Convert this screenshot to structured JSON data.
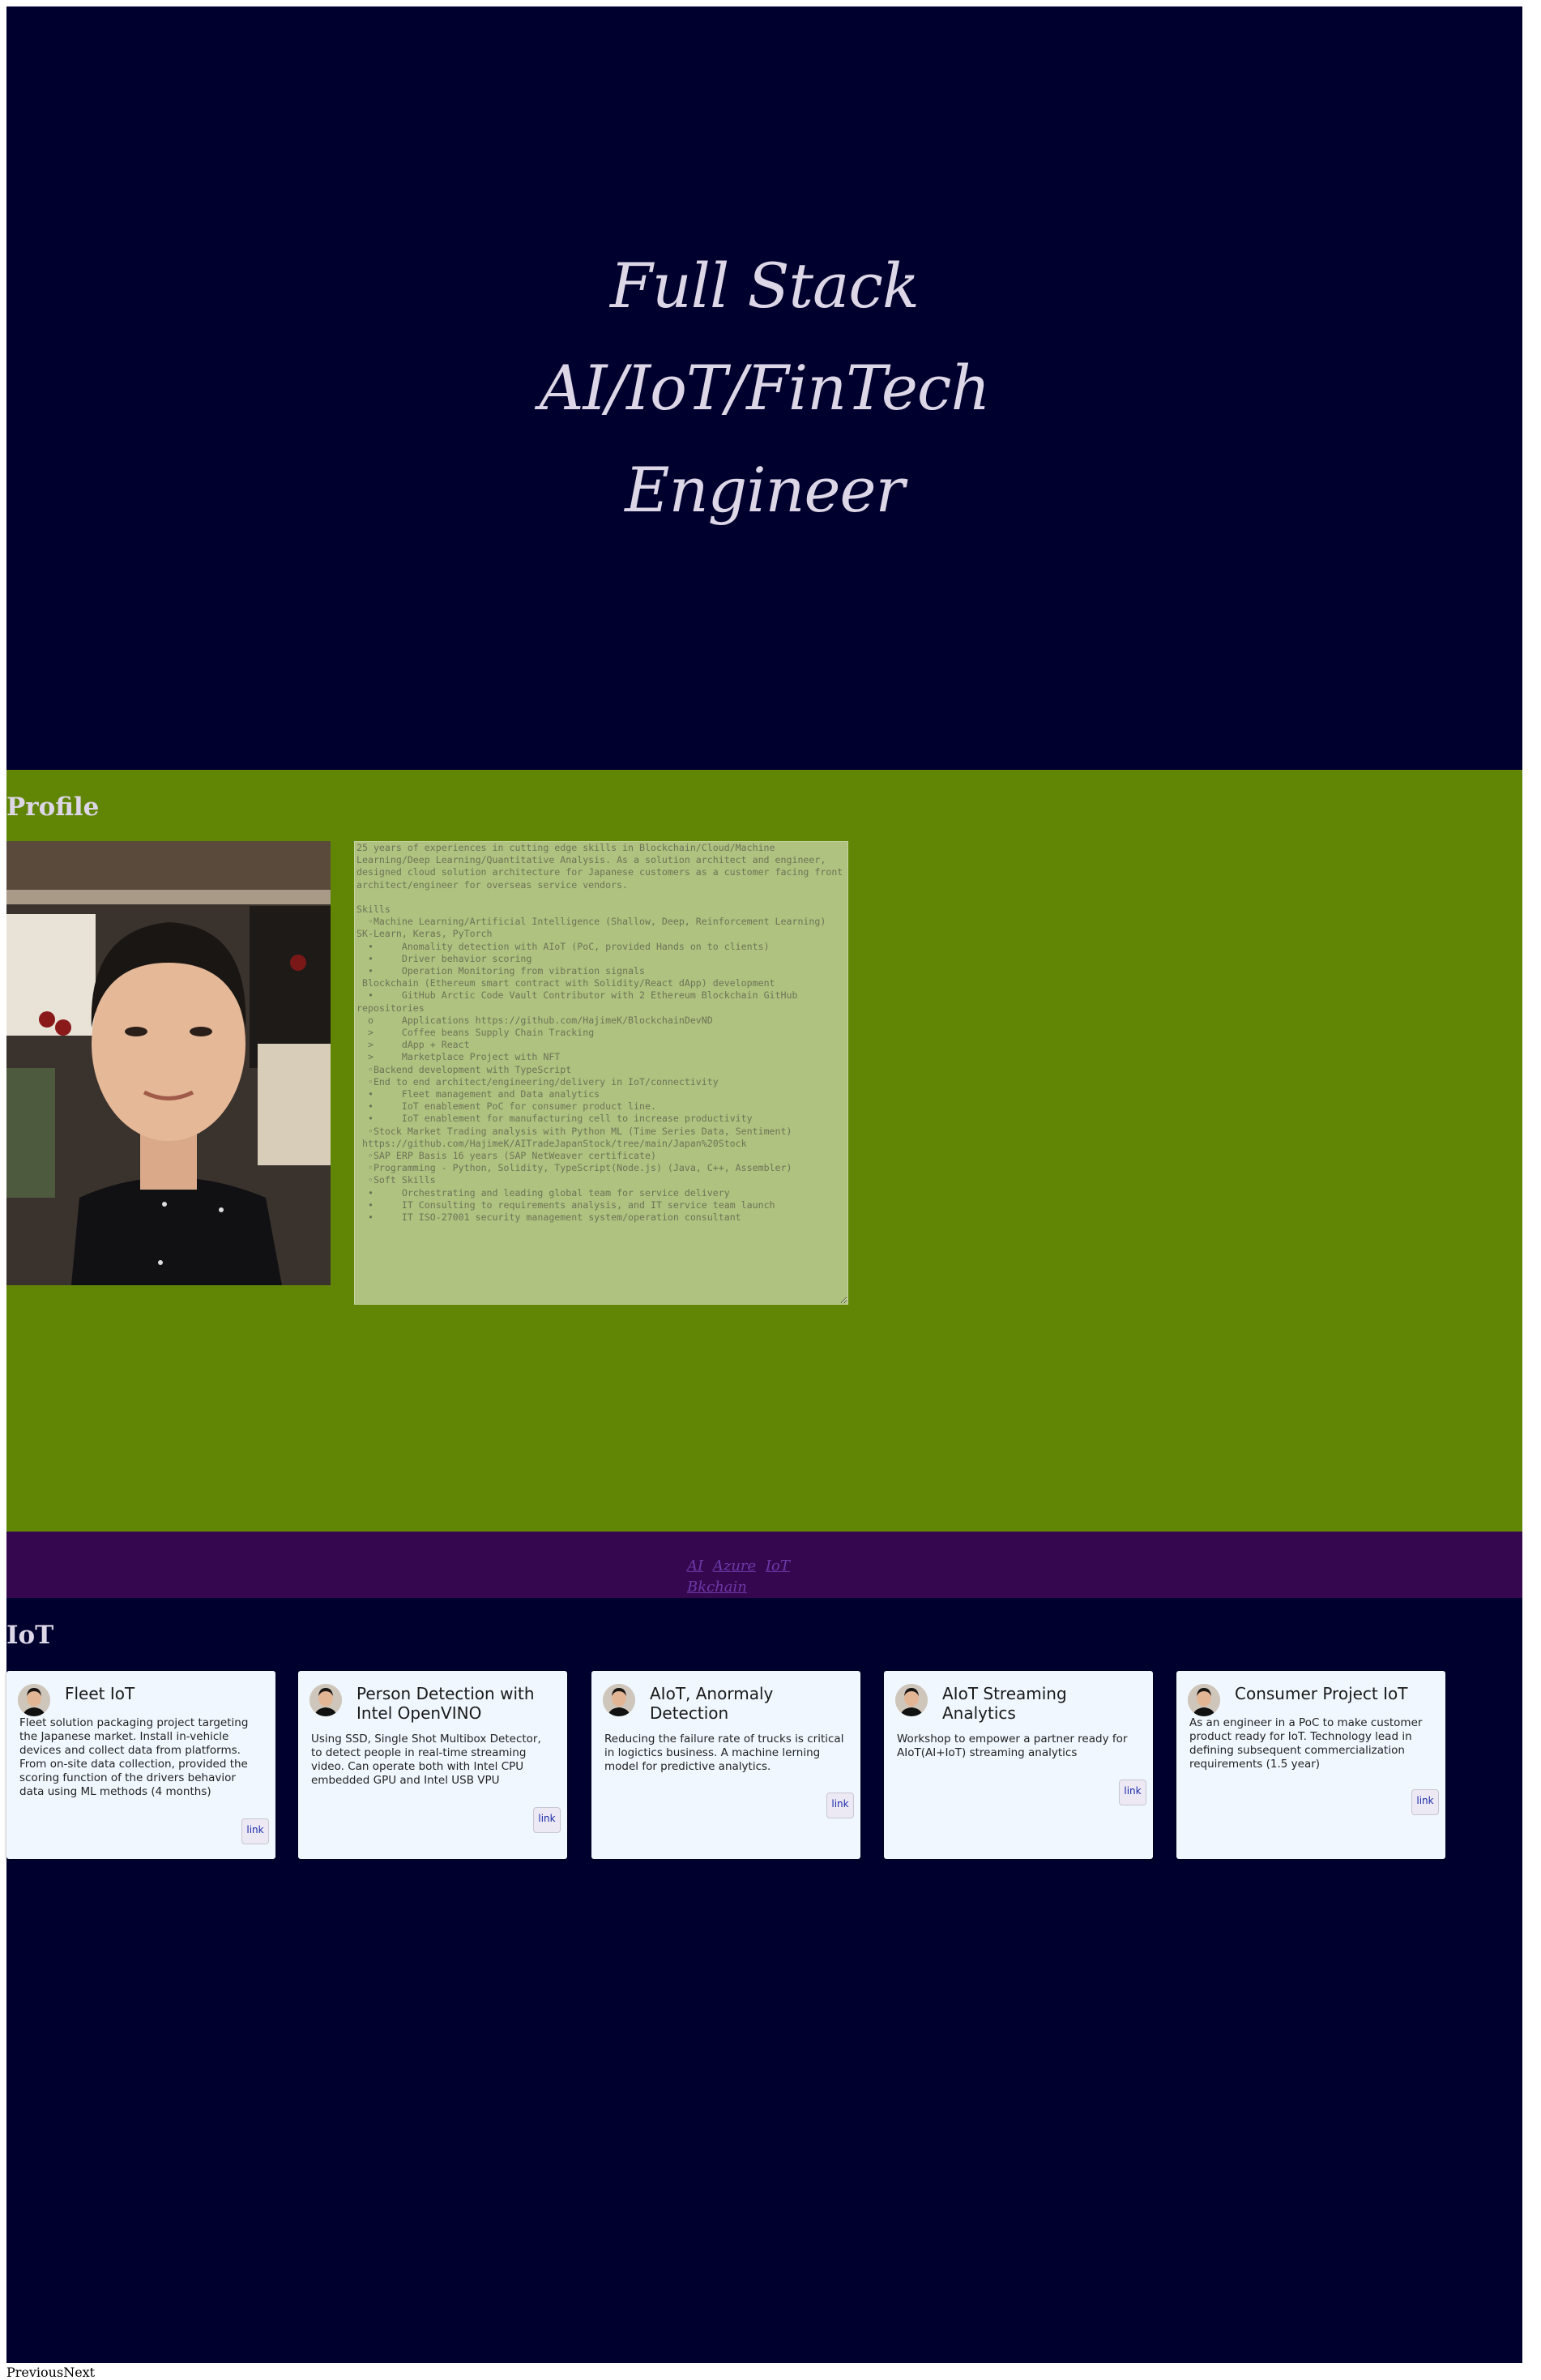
{
  "hero": {
    "line1": "Full Stack",
    "line2": "AI/IoT/FinTech",
    "line3": "Engineer"
  },
  "profile": {
    "heading": "Profile",
    "bio": "25 years of experiences in cutting edge skills in Blockchain/Cloud/Machine Learning/Deep Learning/Quantitative Analysis. As a solution architect and engineer, designed cloud solution architecture for Japanese customers as a customer facing front architect/engineer for overseas service vendors.\n\nSkills\n  ◦Machine Learning/Artificial Intelligence (Shallow, Deep, Reinforcement Learning) SK-Learn, Keras, PyTorch\n  •     Anomality detection with AIoT (PoC, provided Hands on to clients)\n  •     Driver behavior scoring\n  •     Operation Monitoring from vibration signals\n Blockchain (Ethereum smart contract with Solidity/React dApp) development\n  •     GitHub Arctic Code Vault Contributor with 2 Ethereum Blockchain GitHub repositories\n  o     Applications https://github.com/HajimeK/BlockchainDevND\n  >     Coffee beans Supply Chain Tracking\n  >     dApp + React\n  >     Marketplace Project with NFT\n  ◦Backend development with TypeScript\n  ◦End to end architect/engineering/delivery in IoT/connectivity\n  •     Fleet management and Data analytics\n  •     IoT enablement PoC for consumer product line.\n  •     IoT enablement for manufacturing cell to increase productivity\n  ◦Stock Market Trading analysis with Python ML (Time Series Data, Sentiment)\n https://github.com/HajimeK/AITradeJapanStock/tree/main/Japan%20Stock\n  ◦SAP ERP Basis 16 years (SAP NetWeaver certificate)\n  ◦Programming - Python, Solidity, TypeScript(Node.js) (Java, C++, Assembler)\n  ◦Soft Skills\n  •     Orchestrating and leading global team for service delivery\n  •     IT Consulting to requirements analysis, and IT service team launch\n  •     IT ISO-27001 security management system/operation consultant"
  },
  "nav": {
    "links_row1": [
      "AI",
      "Azure",
      "IoT"
    ],
    "links_row2": [
      "Bkchain"
    ]
  },
  "iot": {
    "heading": "IoT",
    "cards": [
      {
        "title": "Fleet IoT",
        "description": "Fleet solution packaging project targeting the Japanese market. Install in-vehicle devices and collect data from platforms. From on-site data collection, provided the scoring function of the drivers behavior data using ML methods (4 months)",
        "link": "link"
      },
      {
        "title": "Person Detection with Intel OpenVINO",
        "description": "Using SSD, Single Shot Multibox Detector, to detect people in real-time streaming video. Can operate both with Intel CPU embedded GPU and Intel USB VPU",
        "link": "link"
      },
      {
        "title": "AIoT, Anormaly Detection",
        "description": "Reducing the failure rate of trucks is critical in logictics business. A machine lerning model for predictive analytics.",
        "link": "link"
      },
      {
        "title": "AIoT Streaming Analytics",
        "description": "Workshop to empower a partner ready for AIoT(AI+IoT) streaming analytics",
        "link": "link"
      },
      {
        "title": "Consumer Project IoT",
        "description": "As an engineer in a PoC to make customer product ready for IoT. Technology lead in defining subsequent commercialization requirements (1.5 year)",
        "link": "link"
      }
    ]
  },
  "pager": {
    "previous": "Previous",
    "next": "Next"
  },
  "colors": {
    "hero_bg": "#00002e",
    "profile_bg": "#618606",
    "nav_bg": "#34074e",
    "card_bg": "#f0f7ff"
  }
}
